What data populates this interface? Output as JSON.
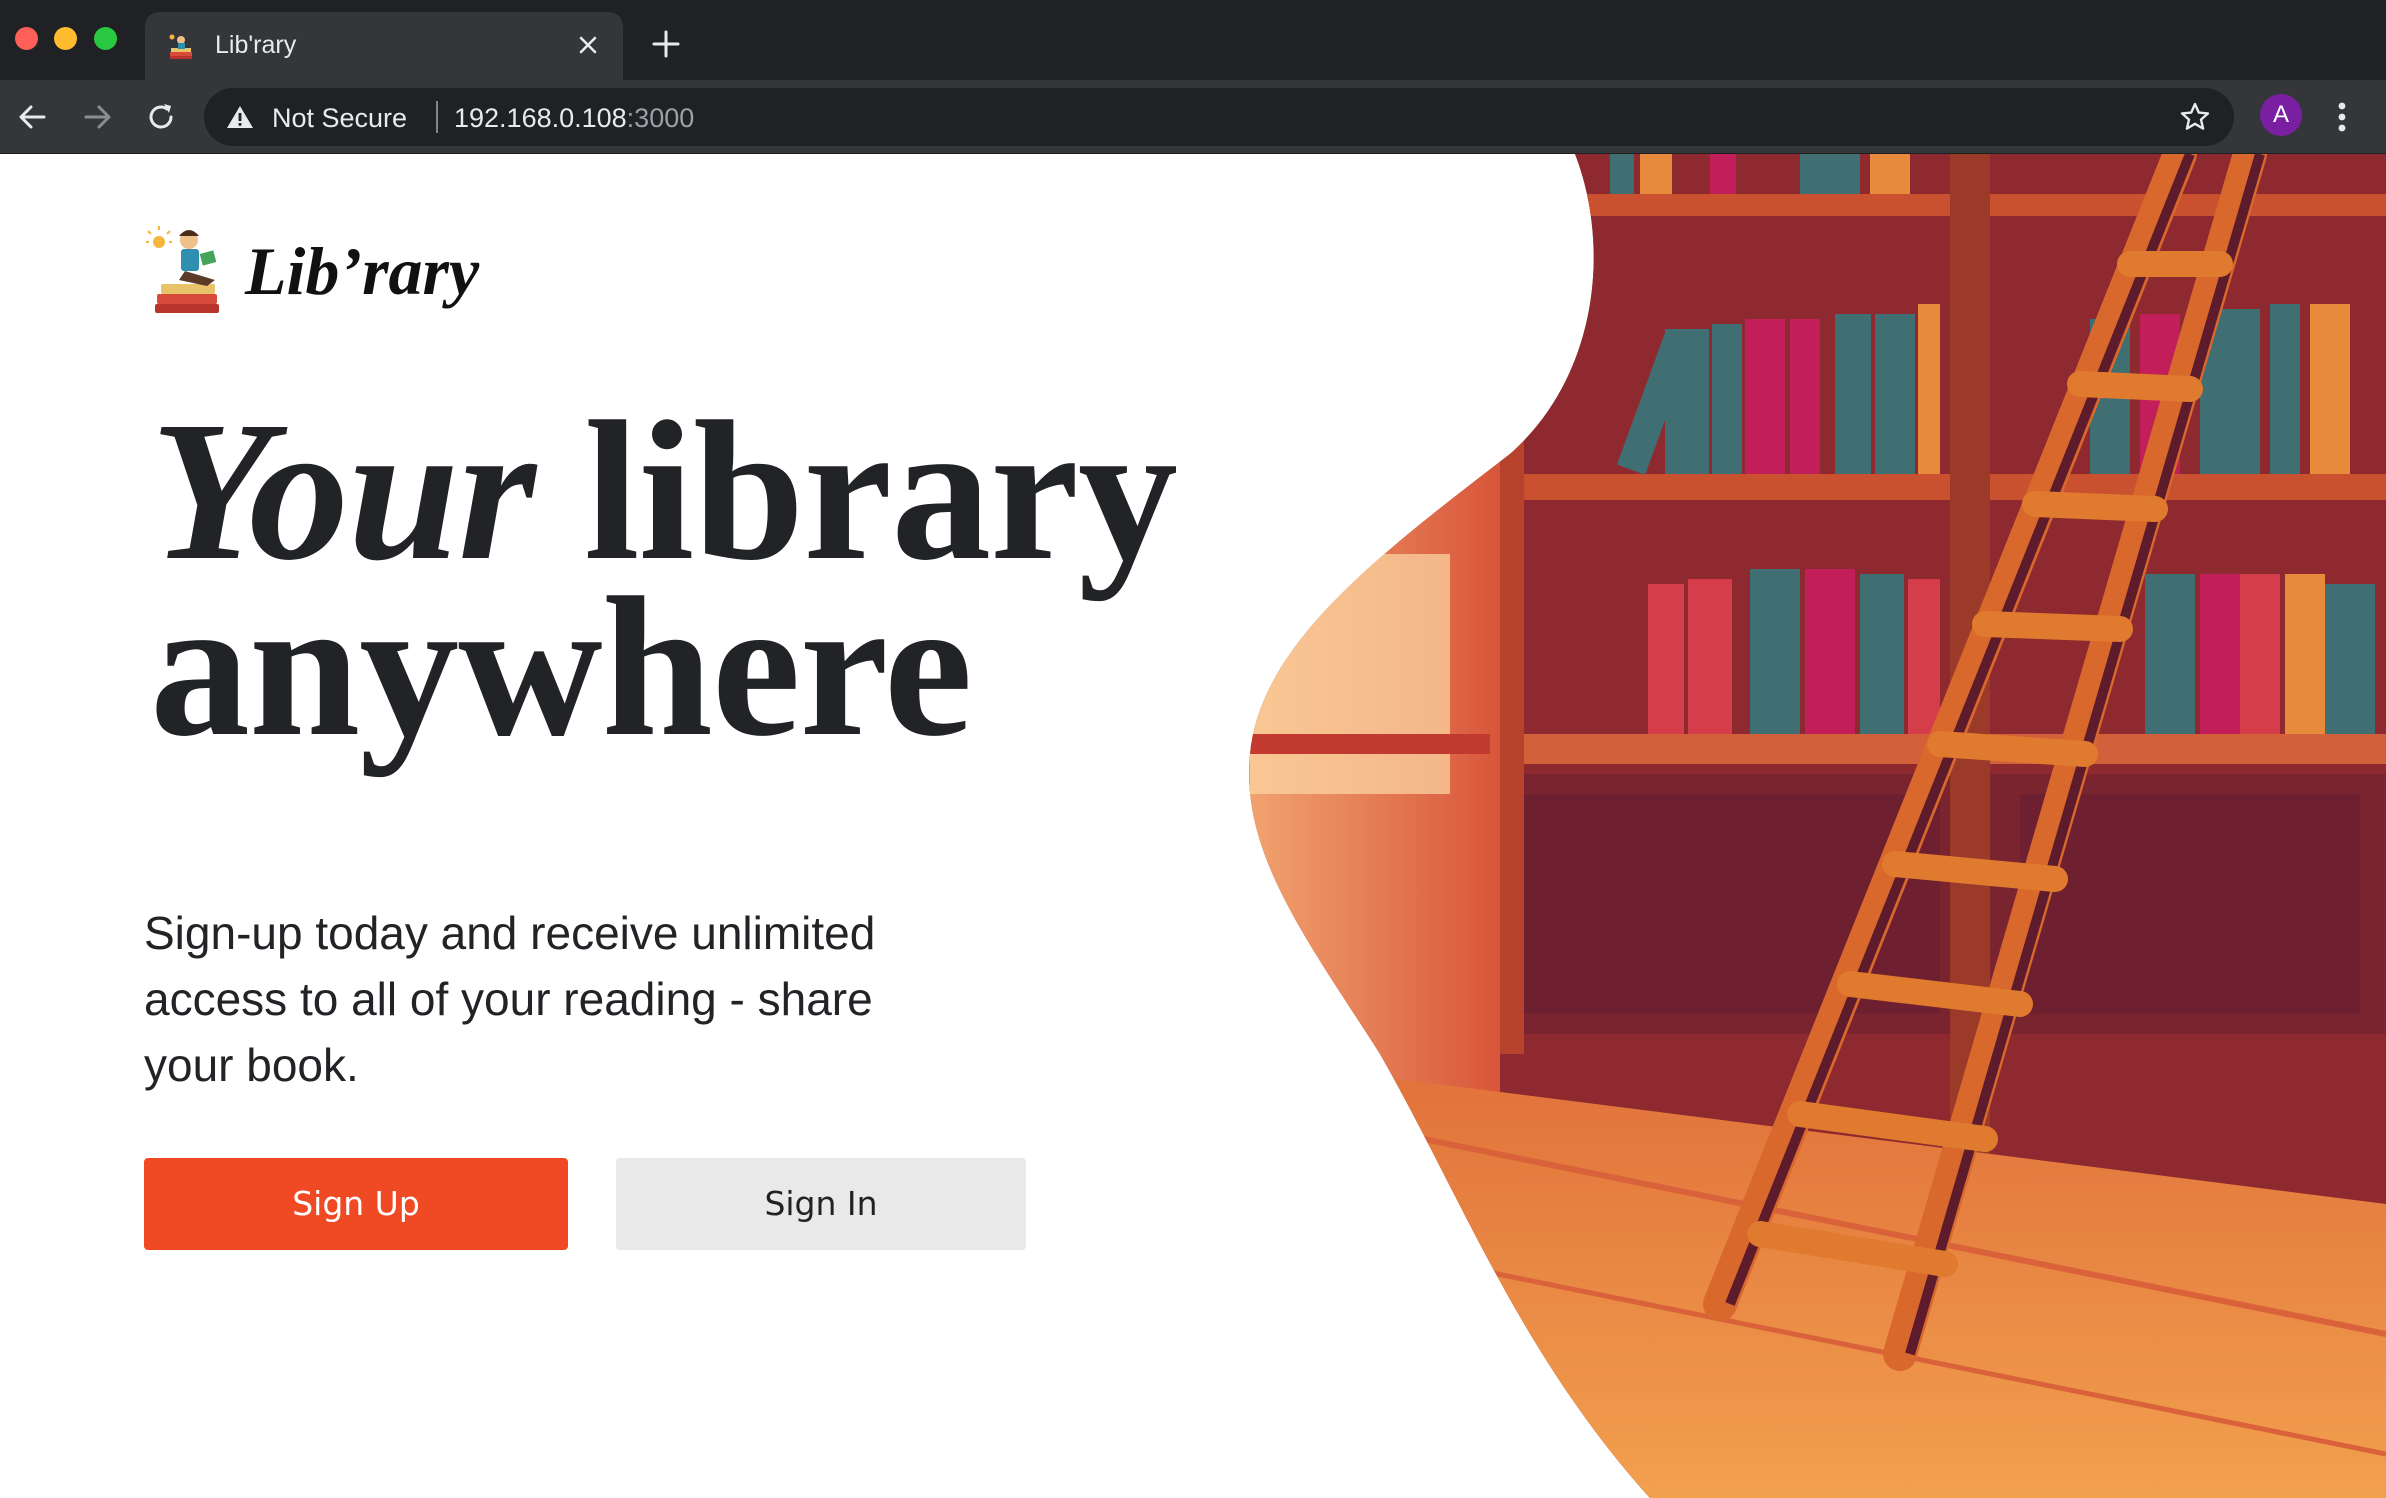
{
  "browser": {
    "tab_title": "Lib'rary",
    "security_label": "Not Secure",
    "url_host": "192.168.0.108",
    "url_port": ":3000",
    "profile_initial": "A"
  },
  "site": {
    "logo_text": "Lib’rary",
    "headline_italic": "Your",
    "headline_line1_rest": " library",
    "headline_line2": "anywhere",
    "subtext": "Sign-up today and receive unlimited access to all of your reading - share your book.",
    "primary_button": "Sign Up",
    "secondary_button": "Sign In"
  },
  "colors": {
    "primary": "#ef4a23",
    "secondary_button_bg": "#e9e9e9",
    "headline": "#212326"
  }
}
